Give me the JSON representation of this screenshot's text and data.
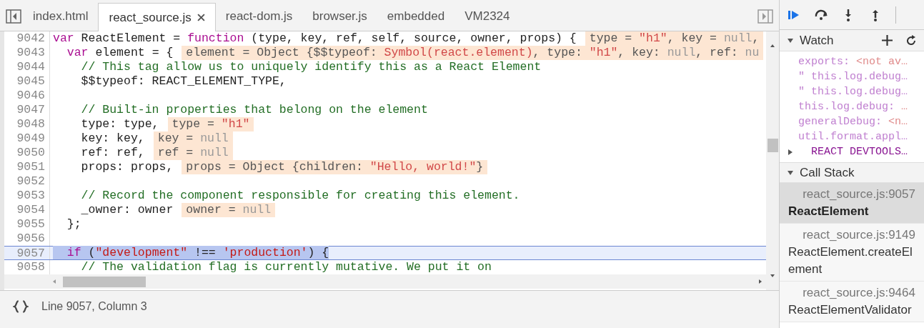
{
  "tabs": [
    {
      "label": "index.html",
      "selected": false,
      "closable": false
    },
    {
      "label": "react_source.js",
      "selected": true,
      "closable": true
    },
    {
      "label": "react-dom.js",
      "selected": false,
      "closable": false
    },
    {
      "label": "browser.js",
      "selected": false,
      "closable": false
    },
    {
      "label": "embedded",
      "selected": false,
      "closable": false
    },
    {
      "label": "VM2324",
      "selected": false,
      "closable": false
    }
  ],
  "editor": {
    "lines": [
      {
        "number": "9042",
        "selected": false,
        "tokens": [
          {
            "kind": "keyword",
            "text": "var"
          },
          {
            "kind": "plain",
            "text": " ReactElement = "
          },
          {
            "kind": "keyword",
            "text": "function"
          },
          {
            "kind": "plain",
            "text": " (type, key, ref, self, source, owner, props) {"
          }
        ],
        "inline": [
          {
            "kind": "plain",
            "text": "type = "
          },
          {
            "kind": "string",
            "text": "\"h1\""
          },
          {
            "kind": "plain",
            "text": ", key = "
          },
          {
            "kind": "null",
            "text": "null"
          },
          {
            "kind": "plain",
            "text": ","
          }
        ]
      },
      {
        "number": "9043",
        "selected": false,
        "tokens": [
          {
            "kind": "keyword",
            "text": "  var"
          },
          {
            "kind": "plain",
            "text": " element = {"
          }
        ],
        "inline": [
          {
            "kind": "plain",
            "text": "element = Object {$$typeof: "
          },
          {
            "kind": "string",
            "text": "Symbol(react.element)"
          },
          {
            "kind": "plain",
            "text": ", type: "
          },
          {
            "kind": "string",
            "text": "\"h1\""
          },
          {
            "kind": "plain",
            "text": ", key: "
          },
          {
            "kind": "null",
            "text": "null"
          },
          {
            "kind": "plain",
            "text": ", ref: "
          },
          {
            "kind": "null",
            "text": "nu"
          }
        ]
      },
      {
        "number": "9044",
        "selected": false,
        "tokens": [
          {
            "kind": "comment",
            "text": "    // This tag allow us to uniquely identify this as a React Element"
          }
        ]
      },
      {
        "number": "9045",
        "selected": false,
        "tokens": [
          {
            "kind": "plain",
            "text": "    $$typeof: REACT_ELEMENT_TYPE,"
          }
        ]
      },
      {
        "number": "9046",
        "selected": false
      },
      {
        "number": "9047",
        "selected": false,
        "tokens": [
          {
            "kind": "comment",
            "text": "    // Built-in properties that belong on the element"
          }
        ]
      },
      {
        "number": "9048",
        "selected": false,
        "tokens": [
          {
            "kind": "plain",
            "text": "    type: type,"
          }
        ],
        "inline": [
          {
            "kind": "plain",
            "text": "type = "
          },
          {
            "kind": "string",
            "text": "\"h1\""
          }
        ]
      },
      {
        "number": "9049",
        "selected": false,
        "tokens": [
          {
            "kind": "plain",
            "text": "    key: key,"
          }
        ],
        "inline": [
          {
            "kind": "plain",
            "text": "key = "
          },
          {
            "kind": "null",
            "text": "null"
          }
        ]
      },
      {
        "number": "9050",
        "selected": false,
        "tokens": [
          {
            "kind": "plain",
            "text": "    ref: ref,"
          }
        ],
        "inline": [
          {
            "kind": "plain",
            "text": "ref = "
          },
          {
            "kind": "null",
            "text": "null"
          }
        ]
      },
      {
        "number": "9051",
        "selected": false,
        "tokens": [
          {
            "kind": "plain",
            "text": "    props: props,"
          }
        ],
        "inline": [
          {
            "kind": "plain",
            "text": "props = Object {children: "
          },
          {
            "kind": "string",
            "text": "\"Hello, world!\""
          },
          {
            "kind": "plain",
            "text": "}"
          }
        ]
      },
      {
        "number": "9052",
        "selected": false
      },
      {
        "number": "9053",
        "selected": false,
        "tokens": [
          {
            "kind": "comment",
            "text": "    // Record the component responsible for creating this element."
          }
        ]
      },
      {
        "number": "9054",
        "selected": false,
        "tokens": [
          {
            "kind": "plain",
            "text": "    _owner: owner"
          }
        ],
        "inline": [
          {
            "kind": "plain",
            "text": "owner = "
          },
          {
            "kind": "null",
            "text": "null"
          }
        ]
      },
      {
        "number": "9055",
        "selected": false,
        "tokens": [
          {
            "kind": "plain",
            "text": "  };"
          }
        ]
      },
      {
        "number": "9056",
        "selected": false
      },
      {
        "number": "9057",
        "selected": true,
        "tokens": [
          {
            "kind": "keyword",
            "text": "  if"
          },
          {
            "kind": "plain",
            "text": " ("
          },
          {
            "kind": "string",
            "text": "\"development\""
          },
          {
            "kind": "plain",
            "text": " !== "
          },
          {
            "kind": "string",
            "text": "'production'"
          },
          {
            "kind": "plain",
            "text": ") {"
          }
        ]
      },
      {
        "number": "9058",
        "selected": false,
        "tokens": [
          {
            "kind": "comment",
            "text": "    // The validation flag is currently mutative. We put it on"
          }
        ]
      }
    ]
  },
  "status_bar": {
    "position": "Line 9057, Column 3"
  },
  "watch": {
    "title": "Watch",
    "items": [
      {
        "kind": "entry",
        "name": "exports:",
        "value": "<not av…"
      },
      {
        "kind": "expression",
        "name": "\" this.log.debug…"
      },
      {
        "kind": "expression",
        "name": "\" this.log.debug…"
      },
      {
        "kind": "entry",
        "name": "this.log.debug:",
        "value": "…"
      },
      {
        "kind": "entry",
        "name": "generalDebug:",
        "value": "<n…"
      },
      {
        "kind": "expression",
        "name": "util.format.appl…"
      },
      {
        "kind": "group",
        "name": "REACT DEVTOOLS…",
        "expanded": false
      }
    ]
  },
  "call_stack": {
    "title": "Call Stack",
    "frames": [
      {
        "location": "react_source.js:9057",
        "name": "ReactElement",
        "selected": true
      },
      {
        "location": "react_source.js:9149",
        "name": "ReactElement.createElement",
        "selected": false
      },
      {
        "location": "react_source.js:9464",
        "name": "ReactElementValidator",
        "selected": false
      }
    ]
  }
}
